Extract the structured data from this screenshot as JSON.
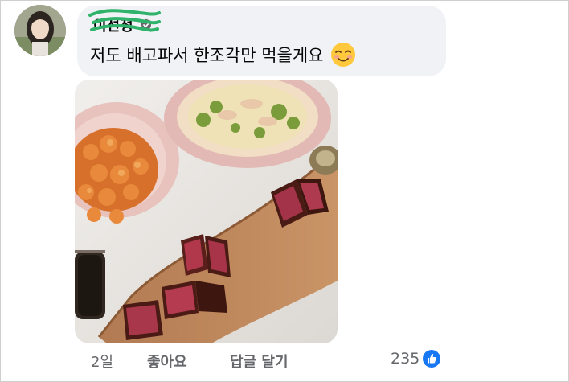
{
  "comment": {
    "author": "이선정",
    "text": "저도 배고파서 한조각만 먹을게요",
    "emoji": "relieved-smile-emoji",
    "verified_icon": "verified-badge-icon",
    "photo_alt": "photo-of-steak-shrimp-pasta"
  },
  "actions": {
    "time": "2일",
    "like": "좋아요",
    "reply": "답글 달기"
  },
  "reactions": {
    "count": "235",
    "icon": "like-reaction-icon"
  },
  "colors": {
    "bubble": "#f0f2f5",
    "secondary_text": "#65676b",
    "like_blue": "#1877f2",
    "scribble": "#2fb36a"
  }
}
